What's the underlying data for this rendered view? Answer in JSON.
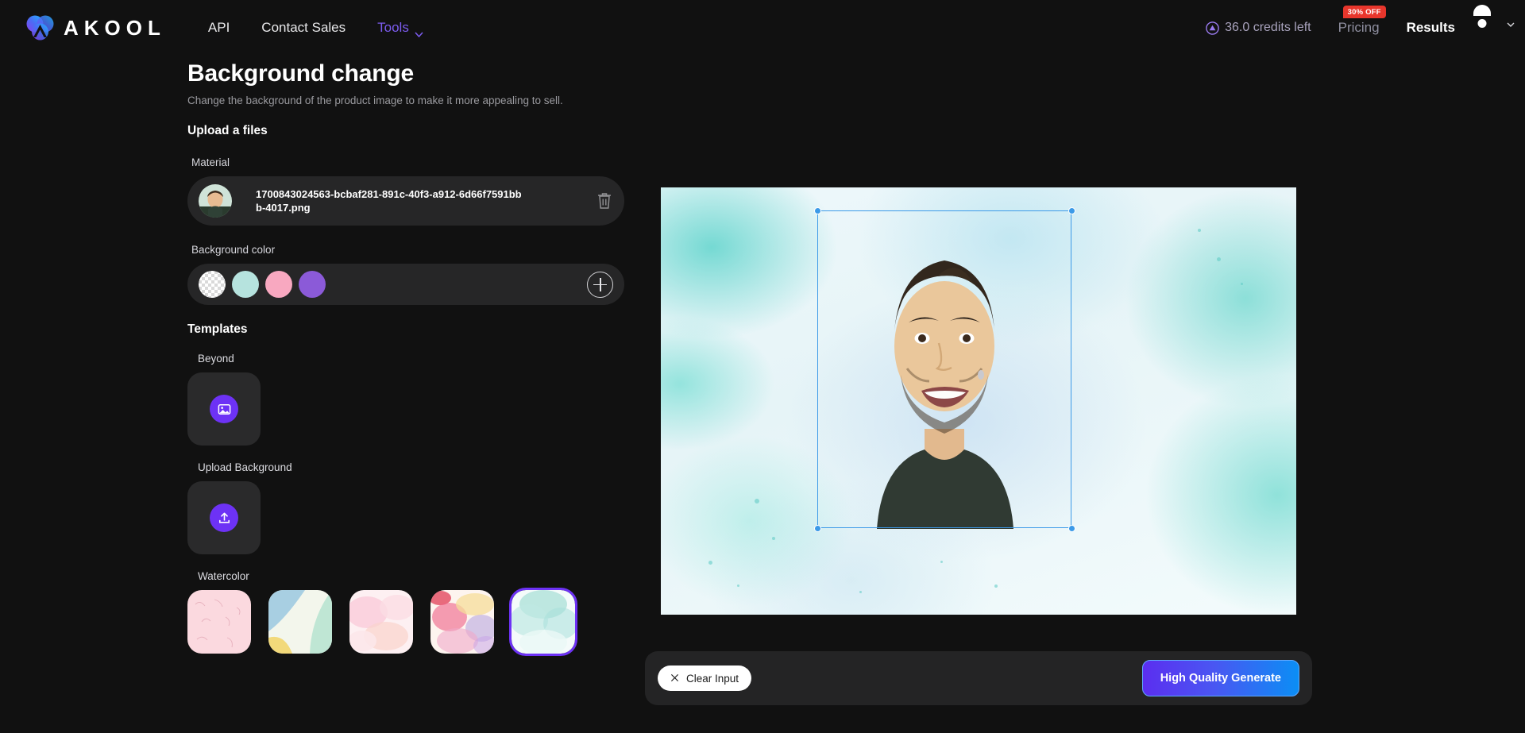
{
  "header": {
    "logo_text": "AKOOL",
    "logo_icon": "akool-logo-icon",
    "nav": [
      {
        "label": "API",
        "name": "nav-item-api"
      },
      {
        "label": "Contact Sales",
        "name": "nav-item-contact-sales"
      },
      {
        "label": "Tools",
        "name": "nav-item-tools"
      }
    ],
    "credits_text": "36.0 credits left",
    "credits_icon": "credit-coin-icon",
    "pricing_label": "Pricing",
    "discount_badge": "30% OFF",
    "results_label": "Results",
    "avatar_icon": "user-avatar-icon",
    "avatar_chevron_icon": "chevron-down-icon",
    "colors": {
      "accent_purple": "#7c5cf0",
      "badge_red": "#e8362c",
      "avatar_purple": "#8a2be2"
    }
  },
  "page": {
    "title": "Background change",
    "subtitle": "Change the background of the product image to make it more appealing to sell.",
    "upload_section_title": "Upload a files"
  },
  "material": {
    "label": "Material",
    "filename": "1700843024563-bcbaf281-891c-40f3-a912-6d66f7591bbb-4017.png",
    "delete_icon": "trash-icon",
    "thumbnail_icon": "portrait-thumbnail"
  },
  "background_color": {
    "label": "Background color",
    "swatches": [
      {
        "name": "swatch-transparent",
        "color": "transparent"
      },
      {
        "name": "swatch-mint",
        "color": "#b6e3de"
      },
      {
        "name": "swatch-pink",
        "color": "#f8a8c0"
      },
      {
        "name": "swatch-purple",
        "color": "#8b5ad8"
      }
    ],
    "add_button_icon": "plus-icon"
  },
  "templates": {
    "section_title": "Templates",
    "groups": [
      {
        "label": "Beyond",
        "tile_icon": "image-icon",
        "name": "template-group-beyond"
      },
      {
        "label": "Upload Background",
        "tile_icon": "upload-icon",
        "name": "template-group-upload-background"
      }
    ],
    "watercolor": {
      "label": "Watercolor",
      "items": [
        {
          "name": "watercolor-thumb-1",
          "selected": false
        },
        {
          "name": "watercolor-thumb-2",
          "selected": false
        },
        {
          "name": "watercolor-thumb-3",
          "selected": false
        },
        {
          "name": "watercolor-thumb-4",
          "selected": false
        },
        {
          "name": "watercolor-thumb-5",
          "selected": true
        }
      ],
      "selected_outline": "#6d32f5"
    }
  },
  "canvas": {
    "name": "preview-canvas",
    "selection_handles": 4,
    "handle_color": "#3c9ae8"
  },
  "bottom_bar": {
    "clear_label": "Clear Input",
    "clear_icon": "close-x-icon",
    "generate_label": "High Quality Generate",
    "generate_gradient_from": "#5b2ef0",
    "generate_gradient_to": "#0b8ef5"
  }
}
